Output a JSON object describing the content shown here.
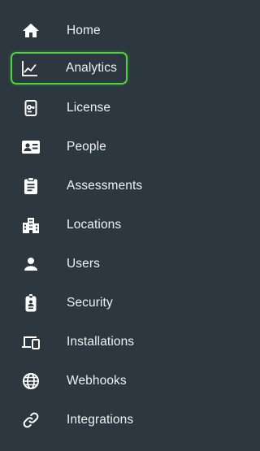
{
  "theme": {
    "background": "#2d373f",
    "text": "#eef2f4",
    "active_outline": "#4ed33f"
  },
  "sidebar": {
    "active_item": "analytics",
    "items": [
      {
        "key": "home",
        "label": "Home",
        "icon": "home-icon"
      },
      {
        "key": "analytics",
        "label": "Analytics",
        "icon": "line-chart-icon"
      },
      {
        "key": "license",
        "label": "License",
        "icon": "license-key-icon"
      },
      {
        "key": "people",
        "label": "People",
        "icon": "id-card-icon"
      },
      {
        "key": "assessments",
        "label": "Assessments",
        "icon": "clipboard-icon"
      },
      {
        "key": "locations",
        "label": "Locations",
        "icon": "building-icon"
      },
      {
        "key": "users",
        "label": "Users",
        "icon": "person-icon"
      },
      {
        "key": "security",
        "label": "Security",
        "icon": "badge-icon"
      },
      {
        "key": "installations",
        "label": "Installations",
        "icon": "devices-icon"
      },
      {
        "key": "webhooks",
        "label": "Webhooks",
        "icon": "globe-icon"
      },
      {
        "key": "integrations",
        "label": "Integrations",
        "icon": "link-icon"
      }
    ]
  }
}
